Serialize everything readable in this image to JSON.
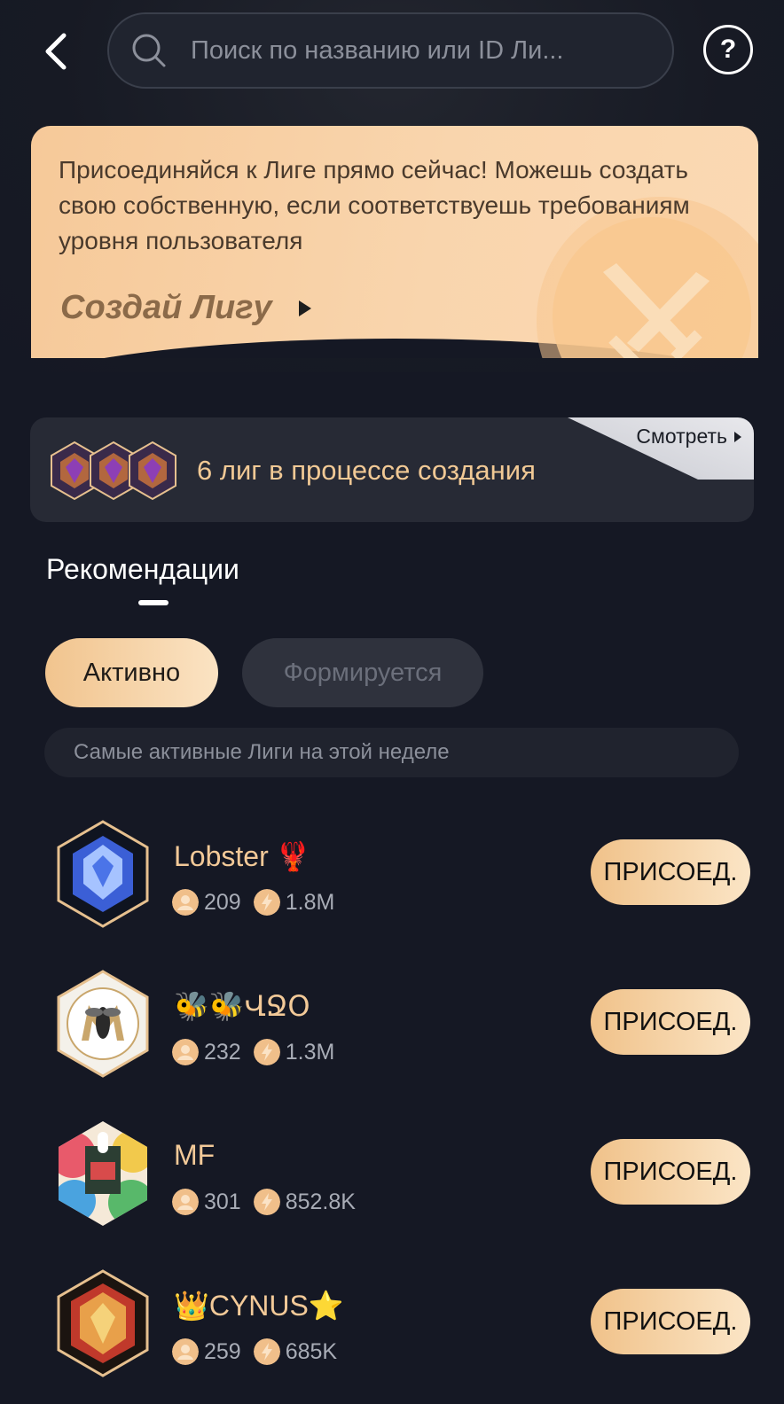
{
  "header": {
    "search_placeholder": "Поиск по названию или ID Ли...",
    "help_label": "?"
  },
  "promo": {
    "text": "Присоединяйся к Лиге прямо сейчас! Можешь создать свою собственную, если соответствуешь требованиям уровня пользователя",
    "cta_label": "Создай Лигу"
  },
  "creating": {
    "text": "6 лиг в процессе создания",
    "view_label": "Смотреть"
  },
  "tabs": {
    "recommendations": "Рекомендации"
  },
  "filters": {
    "active": "Активно",
    "forming": "Формируется"
  },
  "subtitle": "Самые активные Лиги на этой неделе",
  "leagues": [
    {
      "name": "Lobster",
      "emoji": "🦞",
      "members": "209",
      "power": "1.8M",
      "join_label": "ПРИСОЕД."
    },
    {
      "name": "🐝🐝ՎՋՕ",
      "emoji": "",
      "members": "232",
      "power": "1.3M",
      "join_label": "ПРИСОЕД."
    },
    {
      "name": "MF",
      "emoji": "",
      "members": "301",
      "power": "852.8K",
      "join_label": "ПРИСОЕД."
    },
    {
      "name": "👑CYNUS⭐",
      "emoji": "",
      "members": "259",
      "power": "685K",
      "join_label": "ПРИСОЕД."
    }
  ],
  "colors": {
    "background": "#151824",
    "gold_text": "#f2c998",
    "button_gold": "#f0c28a"
  }
}
